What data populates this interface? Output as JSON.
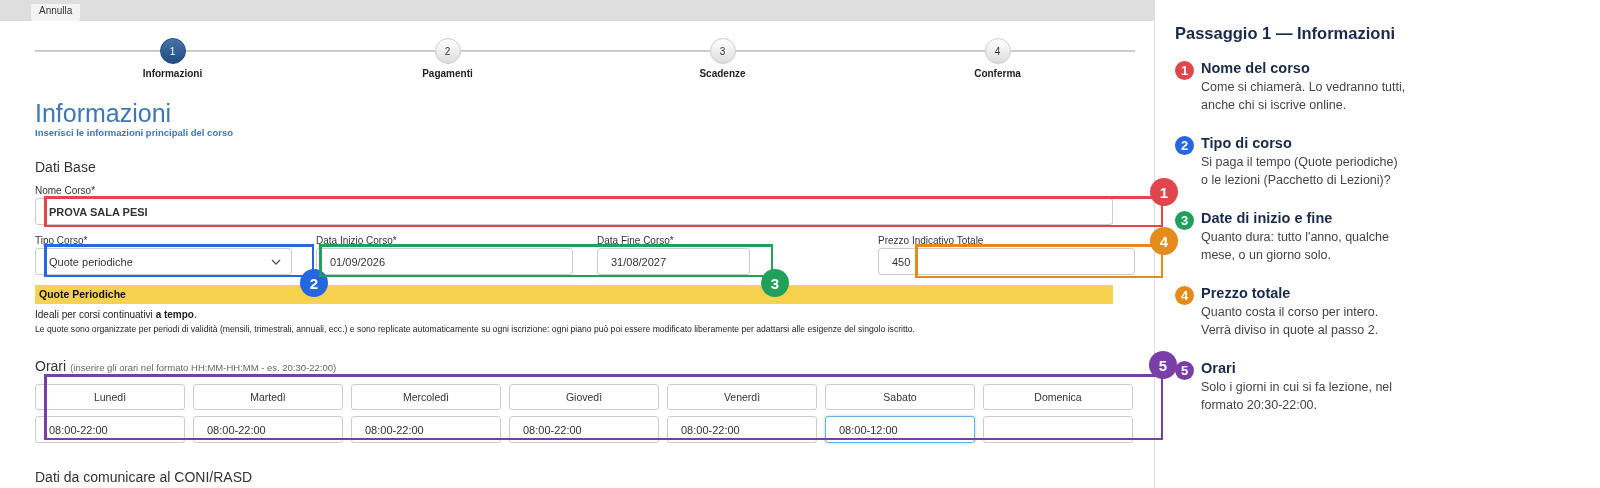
{
  "toolbar": {
    "cancel_button": "Annulla"
  },
  "steps": [
    {
      "number": "1",
      "label": "Informazioni",
      "selected": true
    },
    {
      "number": "2",
      "label": "Pagamenti",
      "selected": false
    },
    {
      "number": "3",
      "label": "Scadenze",
      "selected": false
    },
    {
      "number": "4",
      "label": "Conferma",
      "selected": false
    }
  ],
  "section": {
    "title": "Informazioni",
    "subtitle": "Inserisci le informazioni principali del corso"
  },
  "dati_base": {
    "heading": "Dati Base",
    "nome": {
      "label": "Nome Corso*",
      "value": "PROVA SALA PESI"
    },
    "fields": [
      {
        "kind": "select",
        "label": "Tipo Corso*",
        "value": "Quote periodiche"
      },
      {
        "kind": "text",
        "label": "Data Inizio Corso*",
        "value": "01/09/2026"
      },
      {
        "kind": "short",
        "label": "Data Fine Corso*",
        "value": "31/08/2027"
      },
      {
        "kind": "text",
        "label": "Prezzo Indicativo Totale",
        "value": "450"
      }
    ]
  },
  "info_box": {
    "title": "Quote Periodiche",
    "line_1": "Ideali per corsi continuativi **a tempo**.",
    "line_2": "Le quote sono organizzate per periodi di validità (mensili, trimestrali, annuali, ecc.) e sono replicate automaticamente su ogni iscrizione: ogni piano può poi essere modificato liberamente per adattarsi alle esigenze del singolo iscritto."
  },
  "orari": {
    "heading": "Orari",
    "hint": "(inserire gli orari nel formato HH:MM-HH:MM - es. 20:30-22:00)",
    "days": [
      {
        "day": "Lunedì",
        "value": "08:00-22:00",
        "focused": false
      },
      {
        "day": "Martedì",
        "value": "08:00-22:00",
        "focused": false
      },
      {
        "day": "Mercoledì",
        "value": "08:00-22:00",
        "focused": false
      },
      {
        "day": "Giovedì",
        "value": "08:00-22:00",
        "focused": false
      },
      {
        "day": "Venerdì",
        "value": "08:00-22:00",
        "focused": false
      },
      {
        "day": "Sabato",
        "value": "08:00-12:00",
        "focused": true
      },
      {
        "day": "Domenica",
        "focused": false
      }
    ]
  },
  "next_heading": "Dati da comunicare al CONI/RASD",
  "callouts": [
    {
      "number": "1",
      "color": "#e0474c"
    },
    {
      "number": "2",
      "color": "#2467e0"
    },
    {
      "number": "3",
      "color": "#20a05a"
    },
    {
      "number": "4",
      "color": "#e38b1c"
    },
    {
      "number": "5",
      "color": "#7a3fa6"
    }
  ],
  "guide": {
    "title": "Passaggio 1 — Informazioni",
    "items": [
      {
        "number": "1",
        "color": "#e0474c",
        "title": "Nome del corso",
        "text": "Come si chiamerà. Lo vedranno tutti, anche chi si iscrive online."
      },
      {
        "number": "2",
        "color": "#2467e0",
        "title": "Tipo di corso",
        "text": "Si paga il tempo (Quote periodiche) o le lezioni (Pacchetto di Lezioni)?"
      },
      {
        "number": "3",
        "color": "#20a05a",
        "title": "Date di inizio e fine",
        "text": "Quanto dura: tutto l'anno, qualche mese, o un giorno solo."
      },
      {
        "number": "4",
        "color": "#e38b1c",
        "title": "Prezzo totale",
        "text": "Quanto costa il corso per intero. Verrà diviso in quote al passo 2."
      },
      {
        "number": "5",
        "color": "#7a3fa6",
        "title": "Orari",
        "text": "Solo i giorni in cui si fa lezione, nel formato 20:30-22:00."
      }
    ]
  }
}
